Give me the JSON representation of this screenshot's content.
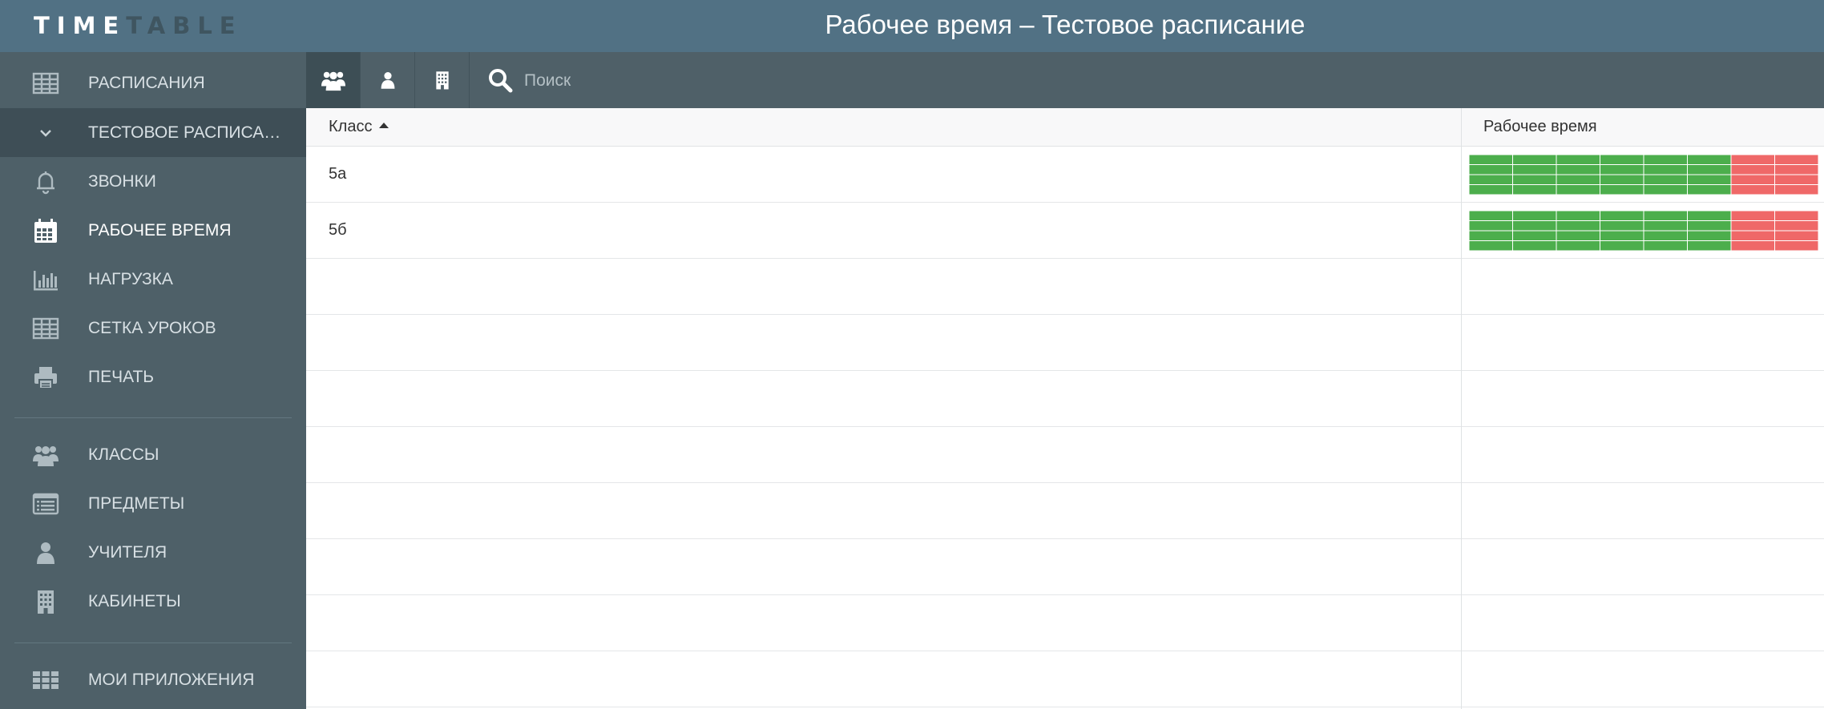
{
  "app": {
    "logo_bright": "TIME",
    "logo_dim": "TABLE",
    "page_title": "Рабочее время – Тестовое расписание"
  },
  "sidebar": {
    "items": [
      {
        "name": "sidebar-item-schedules",
        "icon": "table-grid-icon",
        "label": "Расписания"
      },
      {
        "name": "sidebar-item-test-schedule",
        "icon": "chevron-down-icon",
        "label": "Тестовое расписание",
        "expanded": true
      },
      {
        "name": "sidebar-item-bells",
        "icon": "bell-icon",
        "label": "Звонки"
      },
      {
        "name": "sidebar-item-working-time",
        "icon": "calendar-icon",
        "label": "Рабочее время",
        "active": true
      },
      {
        "name": "sidebar-item-workload",
        "icon": "bar-chart-icon",
        "label": "Нагрузка"
      },
      {
        "name": "sidebar-item-lesson-grid",
        "icon": "table-grid-icon",
        "label": "Сетка уроков"
      },
      {
        "name": "sidebar-item-print",
        "icon": "printer-icon",
        "label": "Печать"
      },
      {
        "name": "sidebar-item-classes",
        "icon": "users-group-icon",
        "label": "Классы"
      },
      {
        "name": "sidebar-item-subjects",
        "icon": "list-icon",
        "label": "Предметы"
      },
      {
        "name": "sidebar-item-teachers",
        "icon": "user-icon",
        "label": "Учителя"
      },
      {
        "name": "sidebar-item-rooms",
        "icon": "building-icon",
        "label": "Кабинеты"
      },
      {
        "name": "sidebar-item-my-apps",
        "icon": "apps-grid-icon",
        "label": "Мои приложения"
      }
    ]
  },
  "toolbar": {
    "tabs": [
      {
        "name": "tab-classes",
        "icon": "users-group-icon",
        "active": true
      },
      {
        "name": "tab-teachers",
        "icon": "user-icon",
        "active": false
      },
      {
        "name": "tab-rooms",
        "icon": "building-icon",
        "active": false
      }
    ],
    "search_placeholder": "Поиск"
  },
  "table": {
    "columns": [
      "Класс",
      "Рабочее время"
    ],
    "sort": {
      "column": "Класс",
      "direction": "asc"
    },
    "rows": [
      {
        "name": "5а",
        "working_days": 6,
        "off_days": 2,
        "periods_per_day": 4
      },
      {
        "name": "5б",
        "working_days": 6,
        "off_days": 2,
        "periods_per_day": 4
      }
    ],
    "empty_rows": 8
  },
  "colors": {
    "header_bg": "#517184",
    "sidebar_bg": "#4e6068",
    "available": "#4cae4c",
    "unavailable": "#ef6868"
  }
}
